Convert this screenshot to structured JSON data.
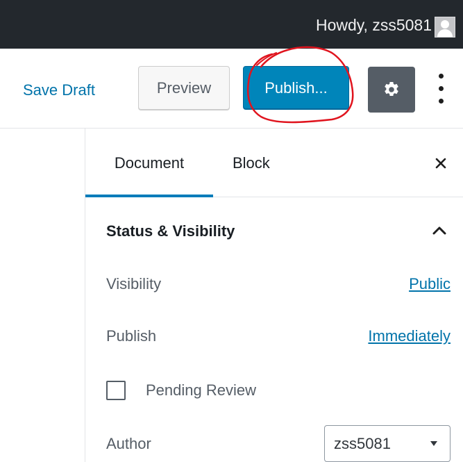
{
  "admin_bar": {
    "greeting": "Howdy, zss5081",
    "avatar_icon": "user-avatar-icon"
  },
  "toolbar": {
    "save_draft_label": "Save Draft",
    "preview_label": "Preview",
    "publish_label": "Publish...",
    "settings_icon": "gear-icon",
    "more_icon": "vertical-ellipsis-icon",
    "publish_color": "#0085ba",
    "annotation_color": "#e0141e"
  },
  "sidebar": {
    "tabs": [
      {
        "label": "Document",
        "active": true
      },
      {
        "label": "Block",
        "active": false
      }
    ],
    "close_icon": "close-icon",
    "panel": {
      "title": "Status & Visibility",
      "expanded": true,
      "chevron_icon": "chevron-up-icon",
      "visibility_label": "Visibility",
      "visibility_value": "Public",
      "publish_label": "Publish",
      "publish_value": "Immediately",
      "pending_review_label": "Pending Review",
      "pending_review_checked": false,
      "author_label": "Author",
      "author_value": "zss5081"
    }
  },
  "colors": {
    "admin_bar_bg": "#23282d",
    "link": "#0073aa",
    "active_tab_underline": "#007cba",
    "settings_button_bg": "#555d66"
  }
}
